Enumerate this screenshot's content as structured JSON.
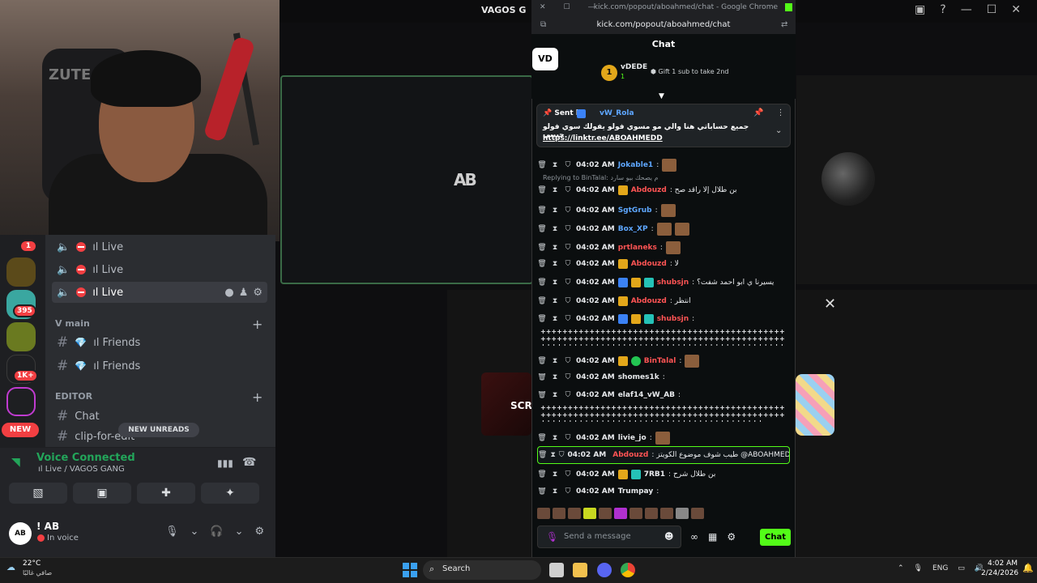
{
  "background": {
    "top_title": "VAGOS G",
    "center_logo": "AB",
    "tile_text": "SCR"
  },
  "discord": {
    "servers": [
      {
        "badge": "1"
      },
      {
        "badge": ""
      },
      {
        "badge": "395"
      },
      {
        "badge": ""
      },
      {
        "badge": "1K+"
      },
      {
        "badge": ""
      }
    ],
    "new_label": "NEW",
    "voice_channels": [
      {
        "label": "ıl Live"
      },
      {
        "label": "ıl Live"
      },
      {
        "label": "ıl Live"
      }
    ],
    "category_main": "V main",
    "text_channels_main": [
      {
        "label": "ıl Friends"
      },
      {
        "label": "ıl Friends"
      }
    ],
    "category_editor": "EDITOR",
    "text_channels_editor": [
      {
        "label": "Chat"
      },
      {
        "label": "clip-for-edit"
      }
    ],
    "new_unreads": "NEW UNREADS",
    "voice_connected": "Voice Connected",
    "voice_sub": "ıl Live / VAGOS GANG",
    "user": {
      "name": "! AB",
      "status": "In voice",
      "avatar": "AB"
    }
  },
  "chrome": {
    "title": "kick.com/popout/aboahmed/chat - Google Chrome",
    "url": "kick.com/popout/aboahmed/chat"
  },
  "kick": {
    "header": "Chat",
    "vd_logo": "VD",
    "top_gifter": {
      "rank": "1",
      "name": "vDEDE",
      "count": "1"
    },
    "gift_cta": "Gift 1 sub to take 2nd",
    "pinned": {
      "sent_by": "Sent by",
      "user": "vW_Rola",
      "message": "جميع حساباتي هنا والي مو مسوي فولو يفولك سوي فولو حبيبي",
      "link": "https://linktr.ee/ABOAHMEDD"
    },
    "reply_to": "Replying to BinTalal: م يصحك بيو سارد",
    "messages": [
      {
        "time": "04:02 AM",
        "user": "Jokable1",
        "color": "#5ea7ff",
        "text": ":",
        "badges": [],
        "emotes": 1
      },
      {
        "time": "04:02 AM",
        "user": "Abdouzd",
        "color": "#ff5454",
        "text": ": بن طلال إلا راقد صح",
        "badges": [
          "crown"
        ],
        "emotes": 0
      },
      {
        "time": "04:02 AM",
        "user": "SgtGrub",
        "color": "#5ea7ff",
        "text": ":",
        "badges": [],
        "emotes": 1
      },
      {
        "time": "04:02 AM",
        "user": "Box_XP",
        "color": "#5ea7ff",
        "text": ":",
        "badges": [],
        "emotes": 2
      },
      {
        "time": "04:02 AM",
        "user": "prtlaneks",
        "color": "#ff5454",
        "text": ":",
        "badges": [],
        "emotes": 1
      },
      {
        "time": "04:02 AM",
        "user": "Abdouzd",
        "color": "#ff5454",
        "text": ": لا",
        "badges": [
          "crown"
        ],
        "emotes": 0
      },
      {
        "time": "04:02 AM",
        "user": "shubsjn",
        "color": "#ff5454",
        "text": ": يسيرنا ي ابو احمد شفت؟",
        "badges": [
          "blue",
          "crown",
          "teal"
        ],
        "emotes": 0
      },
      {
        "time": "04:02 AM",
        "user": "Abdouzd",
        "color": "#ff5454",
        "text": ": انتظر",
        "badges": [
          "crown"
        ],
        "emotes": 0
      },
      {
        "time": "04:02 AM",
        "user": "shubsjn",
        "color": "#ff5454",
        "text": ":",
        "badges": [
          "blue",
          "crown",
          "teal"
        ],
        "emotes": 0
      }
    ],
    "long_line_1": "++++++++++++++++++++++++++++++++++++++++++++++++++++++++++++++++++++++++++++++++++++++++++++++++++++++++++++++++++++++++++++++++++++++++++ح ا++++++++++++",
    "messages2": [
      {
        "time": "04:02 AM",
        "user": "BinTalal",
        "color": "#ff5454",
        "text": ":",
        "badges": [
          "crown",
          "green"
        ],
        "emotes": 1
      },
      {
        "time": "04:02 AM",
        "user": "shomes1k",
        "color": "#e8eaed",
        "text": ":",
        "badges": [],
        "emotes": 0
      },
      {
        "time": "04:02 AM",
        "user": "elaf14_vW_AB",
        "color": "#e8eaed",
        "text": ":",
        "badges": [],
        "emotes": 0
      }
    ],
    "long_line_2": "+++++++++++++++++++++++++++++++++++++++++++++++++++++++++++++++++++++++++++++++++++++++++++++++++++++++++++++++++++++++++++++++++++",
    "messages3": [
      {
        "time": "04:02 AM",
        "user": "livie_jo",
        "color": "#e8eaed",
        "text": ":",
        "badges": [],
        "emotes": 1
      }
    ],
    "highlight": {
      "time": "04:02 AM",
      "user": "Abdouzd",
      "color": "#ff5454",
      "text": ": طيب شوف موضوع الكويتز @ABOAHMED"
    },
    "messages4": [
      {
        "time": "04:02 AM",
        "user": "7RB1",
        "color": "#e8eaed",
        "text": ": بن طلال شرح",
        "badges": [
          "crown",
          "teal"
        ],
        "emotes": 0
      },
      {
        "time": "04:02 AM",
        "user": "Trumpay",
        "color": "#e8eaed",
        "text": ":",
        "badges": [],
        "emotes": 0
      }
    ],
    "send_placeholder": "Send a message",
    "chat_button": "Chat"
  },
  "taskbar": {
    "temp": "22°C",
    "weather": "صافي غالبًا",
    "search": "Search",
    "lang": "ENG",
    "time": "4:02 AM",
    "date": "2/24/2026"
  }
}
